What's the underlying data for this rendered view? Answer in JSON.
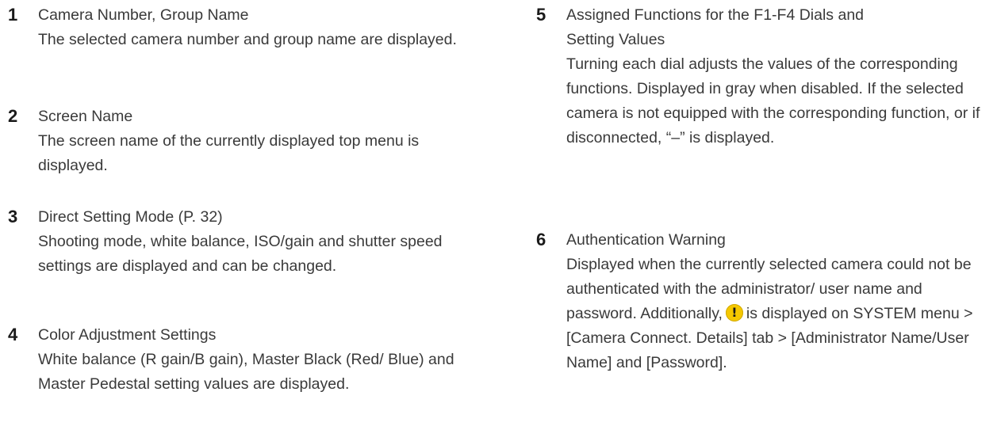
{
  "items": [
    {
      "number": "1",
      "title": "Camera Number, Group Name",
      "description": "The selected camera number and group name are displayed."
    },
    {
      "number": "2",
      "title": "Screen Name",
      "description": "The screen name of the currently displayed top menu is displayed."
    },
    {
      "number": "3",
      "title": "Direct Setting Mode (P. 32)",
      "description": "Shooting mode, white balance, ISO/gain and shutter speed settings are displayed and can be changed."
    },
    {
      "number": "4",
      "title": "Color Adjustment Settings",
      "description": "White balance (R gain/B gain), Master Black (Red/ Blue) and Master Pedestal setting values are displayed."
    },
    {
      "number": "5",
      "title": "Assigned Functions for the F1-F4 Dials and Setting Values",
      "description": "Turning each dial adjusts the values of the corresponding functions. Displayed in gray when disabled. If the selected camera is not equipped with the corresponding function, or if disconnected, “–” is displayed."
    },
    {
      "number": "6",
      "title": "Authentication Warning",
      "description_before_icon": "Displayed when the currently selected camera could not be authenticated with the administrator/ user name and password. Additionally,",
      "description_after_icon": "is displayed on SYSTEM menu > [Camera Connect. Details] tab > [Administrator Name/User Name] and [Password].",
      "icon": "warning-icon",
      "icon_color": "#f5c800"
    }
  ]
}
